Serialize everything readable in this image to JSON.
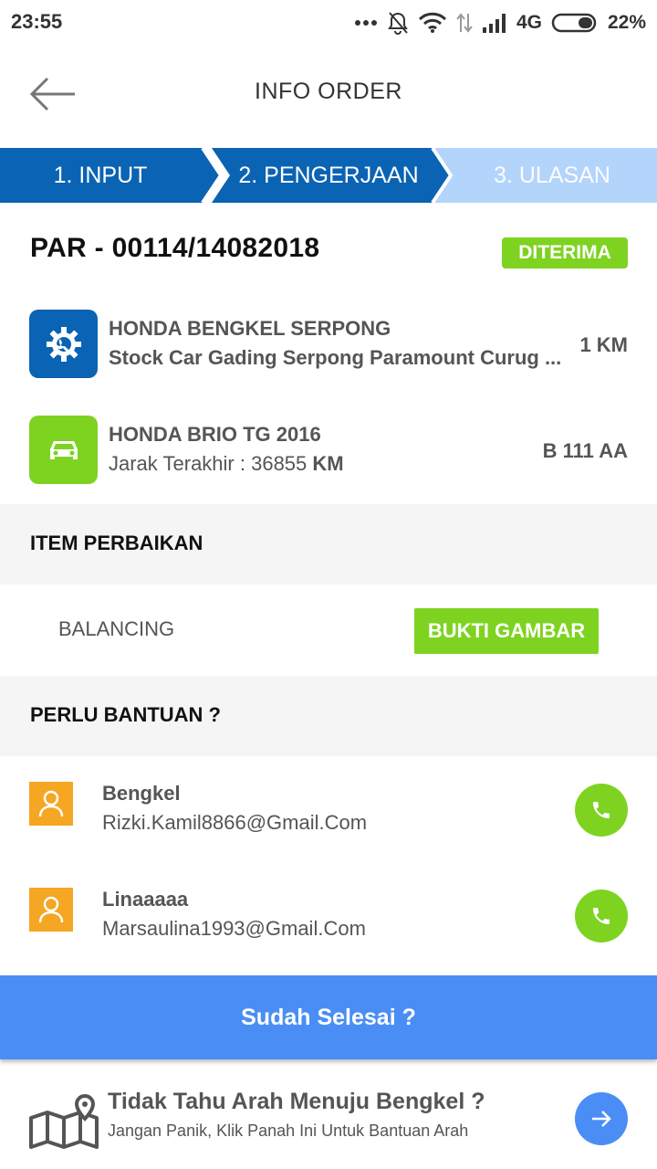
{
  "status_bar": {
    "time": "23:55",
    "network": "4G",
    "battery": "22%"
  },
  "appbar": {
    "title": "INFO ORDER",
    "back_icon": "arrow-left-icon"
  },
  "steps": [
    {
      "label": "1. INPUT",
      "state": "done"
    },
    {
      "label": "2. PENGERJAAN",
      "state": "active"
    },
    {
      "label": "3. ULASAN",
      "state": "pending"
    }
  ],
  "order": {
    "id": "PAR - 00114/14082018",
    "status": "DITERIMA"
  },
  "workshop": {
    "icon": "gear-wrench-icon",
    "name": "HONDA BENGKEL SERPONG",
    "address": "Stock Car Gading Serpong Paramount Curug ...",
    "distance": "1 KM"
  },
  "vehicle": {
    "icon": "car-icon",
    "name": "HONDA BRIO TG 2016",
    "mileage_label": "Jarak Terakhir : 36855",
    "mileage_unit": "KM",
    "plate": "B 111 AA"
  },
  "repair_section": {
    "title": "ITEM PERBAIKAN",
    "items": [
      {
        "name": "BALANCING",
        "button": "BUKTI GAMBAR"
      }
    ]
  },
  "help_section": {
    "title": "PERLU BANTUAN ?",
    "contacts": [
      {
        "name": "Bengkel",
        "email": "Rizki.Kamil8866@Gmail.Com"
      },
      {
        "name": "Linaaaaa",
        "email": "Marsaulina1993@Gmail.Com"
      }
    ]
  },
  "done_button": "Sudah Selesai ?",
  "route_help": {
    "title": "Tidak Tahu Arah Menuju Bengkel ?",
    "subtitle": "Jangan Panik, Klik Panah Ini Untuk Bantuan Arah"
  },
  "colors": {
    "primary_blue": "#0a63b3",
    "light_blue": "#b3d4fb",
    "accent_green": "#7ed321",
    "button_blue": "#4a8ef5",
    "avatar_orange": "#f5a623"
  }
}
